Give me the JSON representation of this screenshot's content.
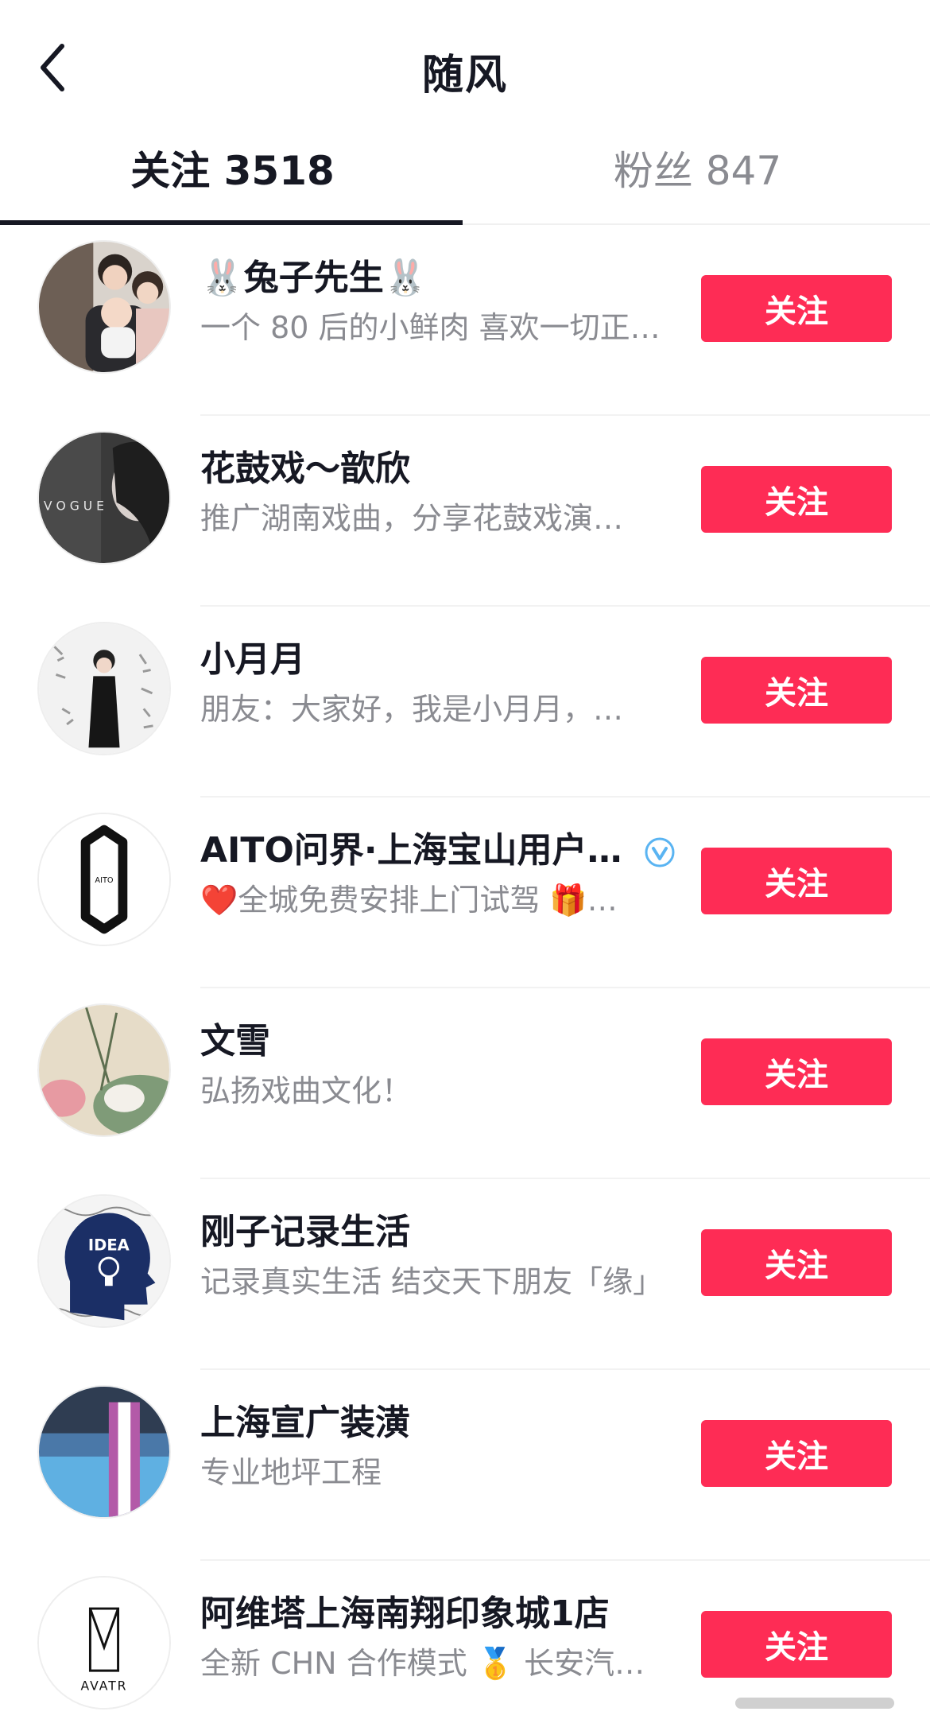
{
  "header": {
    "title": "随风"
  },
  "tabs": [
    {
      "label": "关注 3518",
      "active": true
    },
    {
      "label": "粉丝 847",
      "active": false
    }
  ],
  "accent_color": "#fe2c55",
  "users": [
    {
      "name": "🐰兔子先生🐰",
      "desc": "一个 80 后的小鲜肉 喜欢一切正…",
      "button": "关注",
      "verified": false
    },
    {
      "name": "花鼓戏～歆欣",
      "desc": "推广湖南戏曲，分享花鼓戏演…",
      "button": "关注",
      "verified": false
    },
    {
      "name": "小月月",
      "desc": "朋友：大家好，我是小月月，…",
      "button": "关注",
      "verified": false
    },
    {
      "name": "AITO问界·上海宝山用户…",
      "desc": "❤️全城免费安排上门试驾 🎁…",
      "button": "关注",
      "verified": true
    },
    {
      "name": "文雪",
      "desc": "弘扬戏曲文化！",
      "button": "关注",
      "verified": false
    },
    {
      "name": "刚子记录生活",
      "desc": "记录真实生活 结交天下朋友「缘」",
      "button": "关注",
      "verified": false
    },
    {
      "name": "上海宣广装潢",
      "desc": "专业地坪工程",
      "button": "关注",
      "verified": false
    },
    {
      "name": "阿维塔上海南翔印象城1店",
      "desc": "全新 CHN 合作模式 🥇 长安汽…",
      "button": "关注",
      "verified": false
    }
  ],
  "avatar_texts": {
    "vogue": "V O G U E",
    "aito": "AITO",
    "idea": "IDEA",
    "avatr": "AVATR"
  }
}
